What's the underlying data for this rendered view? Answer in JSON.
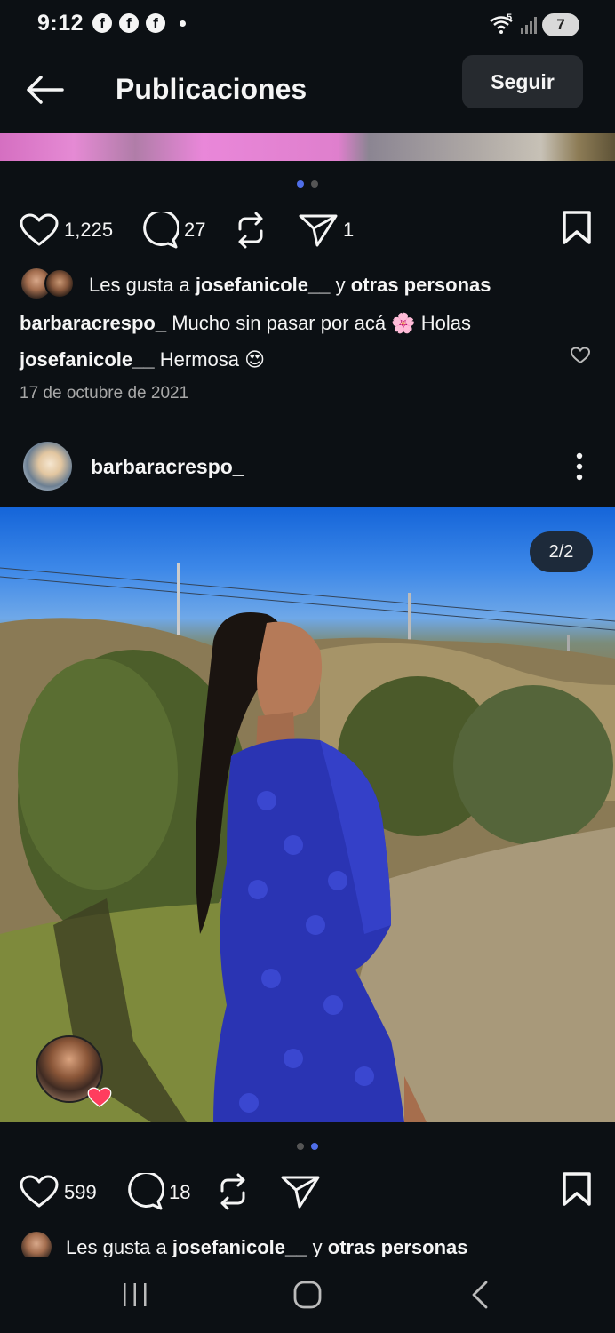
{
  "status_bar": {
    "time": "9:12",
    "notifications": [
      "f",
      "f",
      "f"
    ],
    "signal_label": "5",
    "notification_count": "7"
  },
  "header": {
    "title": "Publicaciones",
    "follow_label": "Seguir"
  },
  "post1": {
    "image_index": 1,
    "image_total": 2,
    "likes": "1,225",
    "comments": "27",
    "shares": "1",
    "liked_by_prefix": "Les gusta a",
    "liked_by_user": "josefanicole__",
    "liked_by_connector": "y",
    "liked_by_suffix": "otras personas",
    "caption_user": "barbaracrespo_",
    "caption_text": "Mucho sin pasar por acá 🌸 Holas",
    "comment_user": "josefanicole__",
    "comment_text": "Hermosa 😍",
    "date": "17 de octubre de 2021"
  },
  "post2": {
    "username": "barbaracrespo_",
    "image_counter": "2/2",
    "image_index": 2,
    "image_total": 2,
    "likes": "599",
    "comments": "18",
    "liked_by_prefix": "Les gusta a",
    "liked_by_user": "josefanicole__",
    "liked_by_connector": "y",
    "liked_by_suffix": "otras personas"
  },
  "colors": {
    "background": "#0c1014",
    "text": "#f5f5f5",
    "secondary_text": "#a8a8a8",
    "pager_active": "#4f6ee8",
    "heart_red": "#ff3d5e"
  },
  "icons": [
    "back-arrow-icon",
    "heart-icon",
    "comment-icon",
    "repost-icon",
    "send-icon",
    "bookmark-icon",
    "more-icon",
    "recent-apps-icon",
    "home-icon",
    "back-icon"
  ]
}
